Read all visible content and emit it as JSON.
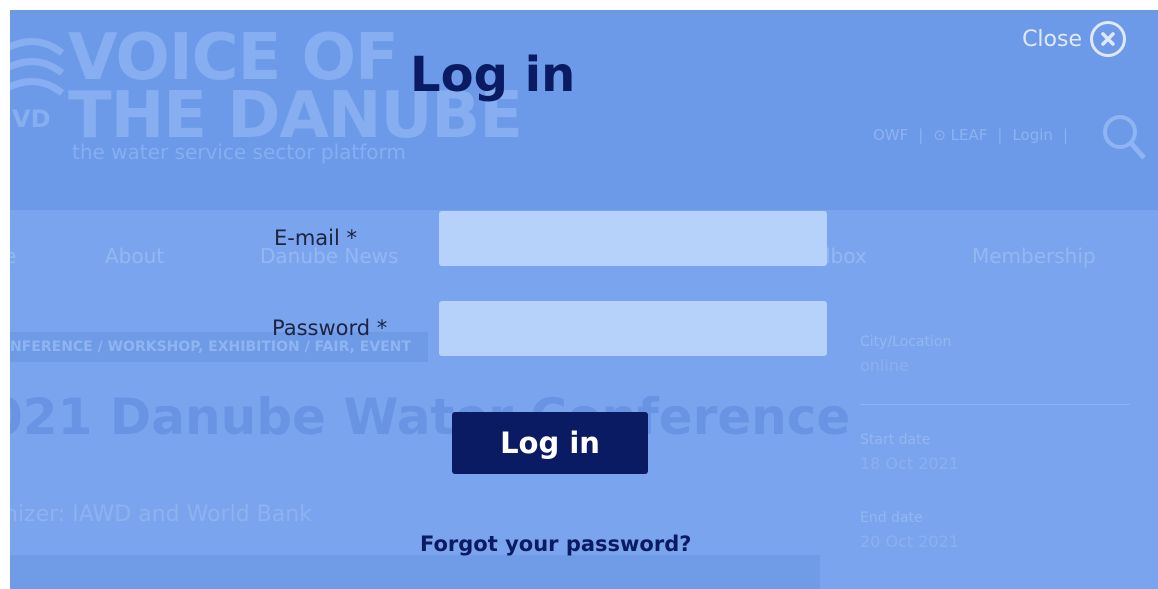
{
  "background": {
    "logo": {
      "line1": "VOICE OF",
      "line2": "THE DANUBE",
      "side_text": "VD",
      "tagline": "the water service sector platform"
    },
    "top_links": [
      "OWF",
      "|",
      "⊙ LEAF",
      "|",
      "Login",
      "|"
    ],
    "nav": [
      "e",
      "About",
      "Danube News",
      "lbox",
      "Membership"
    ],
    "tags": "NFERENCE / WORKSHOP, EXHIBITION / FAIR, EVENT",
    "event_title": "021 Danube Water Conference",
    "organizer": "nizer: IAWD and World Bank",
    "sidebar": {
      "city_label": "City/Location",
      "city_value": "online",
      "start_label": "Start date",
      "start_value": "18 Oct 2021",
      "end_label": "End date",
      "end_value": "20 Oct 2021"
    }
  },
  "modal": {
    "close_label": "Close",
    "title": "Log in",
    "email_label": "E-mail *",
    "email_value": "",
    "password_label": "Password *",
    "password_value": "",
    "submit_label": "Log in",
    "forgot_link": "Forgot your password?"
  },
  "colors": {
    "overlay": "#7aa5ee",
    "header": "#6c9ae9",
    "primary": "#0a1a63",
    "input_bg": "#b6d2fb"
  }
}
